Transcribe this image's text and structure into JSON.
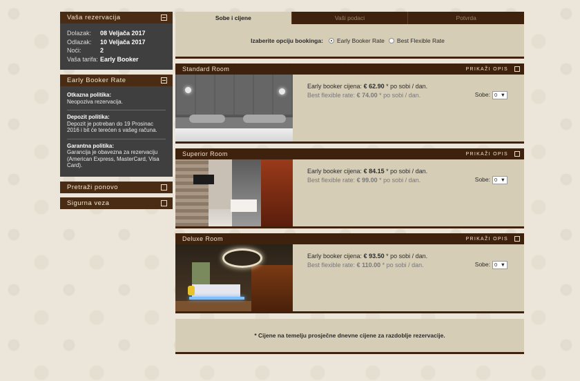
{
  "sidebar": {
    "reservation": {
      "title": "Vaša rezervacija",
      "rows": [
        {
          "label": "Dolazak:",
          "value": "08 Veljača 2017"
        },
        {
          "label": "Odlazak:",
          "value": "10 Veljača 2017"
        },
        {
          "label": "Noći:",
          "value": "2"
        },
        {
          "label": "Vaša tarifa:",
          "value": "Early Booker"
        }
      ]
    },
    "rate": {
      "title": "Early Booker Rate",
      "policies": [
        {
          "title": "Otkazna politika:",
          "text": "Neopoziva rezervacija."
        },
        {
          "title": "Depozit politika:",
          "text": "Depozit je potreban do 19 Prosinac 2016 i bit će terećen s vašeg računa."
        },
        {
          "title": "Garantna politika:",
          "text": "Garancija je obavezna za rezervaciju (American Express, MasterCard, Visa Card)."
        }
      ]
    },
    "search_again": "Pretraži ponovo",
    "secure": "Sigurna veza"
  },
  "tabs": [
    {
      "label": "Sobe i cijene",
      "active": true
    },
    {
      "label": "Vaši podaci",
      "active": false
    },
    {
      "label": "Potvrda",
      "active": false
    }
  ],
  "booking": {
    "label": "Izaberite opciju bookinga:",
    "options": [
      {
        "label": "Early Booker Rate",
        "selected": true
      },
      {
        "label": "Best Flexible Rate",
        "selected": false
      }
    ]
  },
  "room_common": {
    "desc_link": "PRIKAŽI OPIS",
    "early_label": "Early booker cijena:",
    "flex_label": "Best flexible rate:",
    "per_unit": "* po sobi / dan.",
    "rooms_label": "Sobe:"
  },
  "rooms": [
    {
      "title": "Standard Room",
      "early_price": "€ 62.90",
      "flex_price": "€ 74.00",
      "qty": "0"
    },
    {
      "title": "Superior Room",
      "early_price": "€ 84.15",
      "flex_price": "€ 99.00",
      "qty": "0"
    },
    {
      "title": "Deluxe Room",
      "early_price": "€ 93.50",
      "flex_price": "€ 110.00",
      "qty": "0"
    }
  ],
  "footer_note": "* Cijene na temelju prosječne dnevne cijene za razdoblje rezervacije.",
  "colors": {
    "header_brown": "#3e220d",
    "panel_beige": "#d6cdb6",
    "sidebar_grey": "#3f3f3f"
  },
  "icons": {
    "collapse": "minus-square-icon",
    "expand": "square-icon",
    "select": "caret-down-icon"
  }
}
